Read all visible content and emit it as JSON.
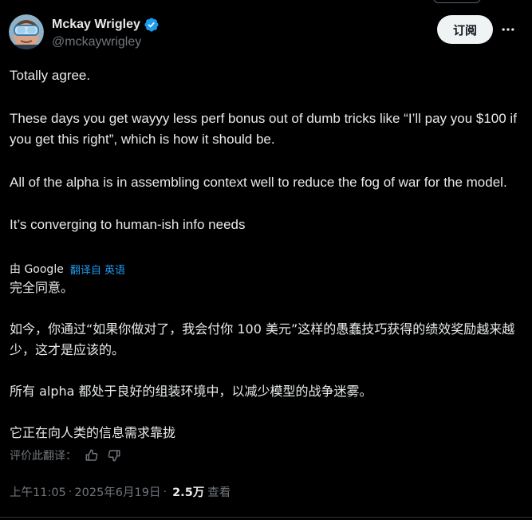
{
  "author": {
    "display_name": "Mckay Wrigley",
    "handle": "@mckaywrigley",
    "verified": true,
    "verified_icon": "verified-badge-icon",
    "avatar_icon": "avatar-goggles"
  },
  "actions": {
    "subscribe_label": "订阅",
    "more_icon": "more-icon"
  },
  "tweet": {
    "paragraphs": [
      "Totally agree.",
      "These days you get wayyy less perf bonus out of dumb tricks like “I’ll pay you $100 if you get this right”, which is how it should be.",
      "All of the alpha is in assembling context well to reduce the fog of war for the model.",
      "It’s converging to human-ish info needs"
    ]
  },
  "translation": {
    "by_label": "由 Google",
    "translated_from": "翻译自 英语",
    "paragraphs": [
      "完全同意。",
      "如今，你通过“如果你做对了，我会付你 100 美元”这样的愚蠢技巧获得的绩效奖励越来越少，这才是应该的。",
      "所有 alpha 都处于良好的组装环境中，以减少模型的战争迷雾。",
      "它正在向人类的信息需求靠拢"
    ],
    "rate_label": "评价此翻译：",
    "thumbs_up_icon": "thumbs-up-icon",
    "thumbs_down_icon": "thumbs-down-icon"
  },
  "meta": {
    "time": "上午11:05",
    "separator": "·",
    "date": "2025年6月19日",
    "views_count": "2.5万",
    "views_label": "查看"
  },
  "colors": {
    "background": "#000000",
    "text": "#e7e9ea",
    "muted": "#71767b",
    "link": "#1d9bf0",
    "verified": "#1d9bf0"
  }
}
